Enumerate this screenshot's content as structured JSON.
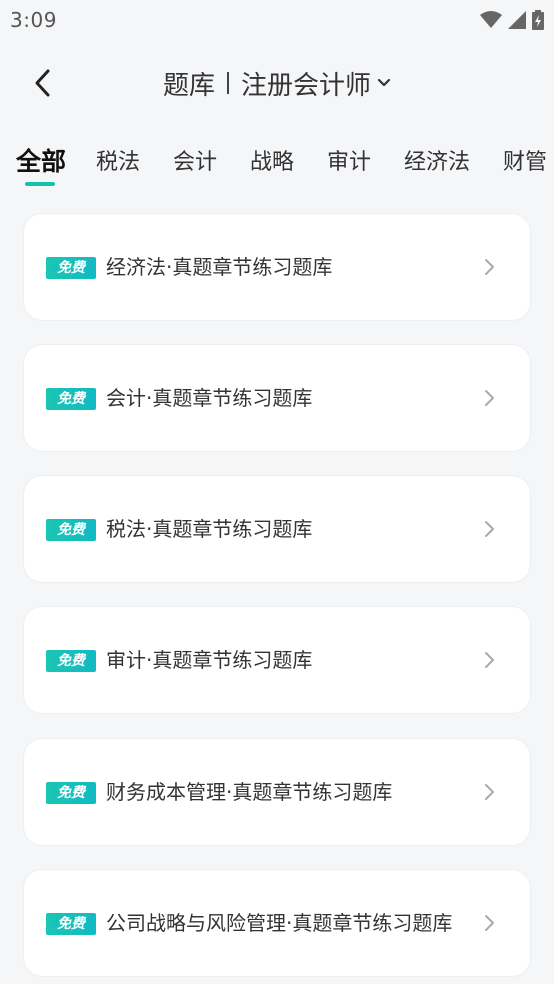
{
  "status": {
    "time": "3:09"
  },
  "nav": {
    "title": "题库",
    "subject": "注册会计师"
  },
  "tabs": [
    "全部",
    "税法",
    "会计",
    "战略",
    "审计",
    "经济法",
    "财管"
  ],
  "badge": "免费",
  "items": [
    "经济法·真题章节练习题库",
    "会计·真题章节练习题库",
    "税法·真题章节练习题库",
    "审计·真题章节练习题库",
    "财务成本管理·真题章节练习题库",
    "公司战略与风险管理·真题章节练习题库"
  ],
  "colors": {
    "accent": "#14c2ad",
    "background": "#f5f6f8"
  }
}
